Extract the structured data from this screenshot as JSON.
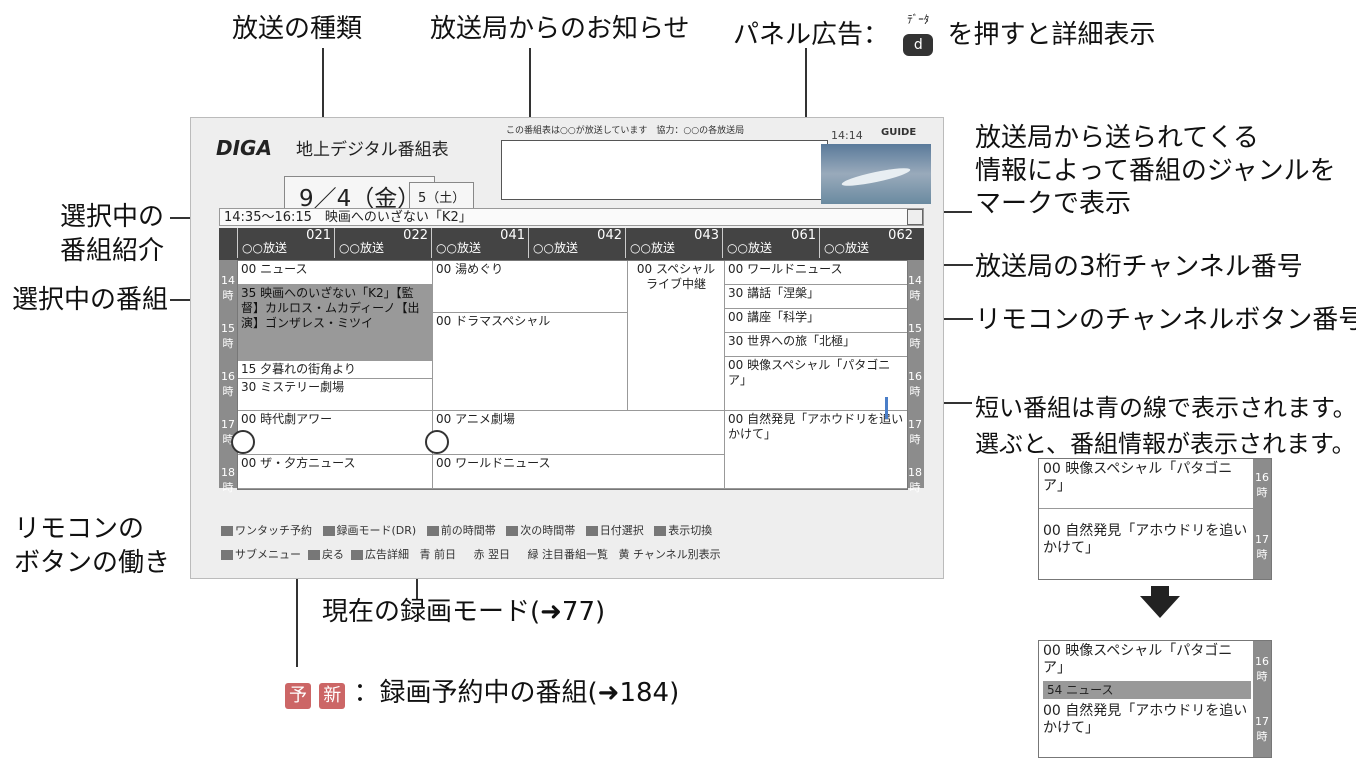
{
  "callouts": {
    "broadcast_type": "放送の種類",
    "station_notice": "放送局からのお知らせ",
    "panel_ad_prefix": "パネル広告：",
    "panel_ad_key_label": "ﾃﾞｰﾀ",
    "panel_ad_suffix": "を押すと詳細表示",
    "genre_mark_line1": "放送局から送られてくる",
    "genre_mark_line2": "情報によって番組のジャンルを",
    "genre_mark_line3": "マークで表示",
    "selected_intro_line1": "選択中の",
    "selected_intro_line2": "番組紹介",
    "selected_program": "選択中の番組",
    "channel_3digit": "放送局の3桁チャンネル番号",
    "remote_channel_button": "リモコンのチャンネルボタン番号",
    "short_program_line1": "短い番組は青の線で表示されます。",
    "short_program_line2": "選ぶと、番組情報が表示されます。",
    "remote_buttons_line1": "リモコンの",
    "remote_buttons_line2": "ボタンの働き",
    "rec_mode": "現在の録画モード(➜77)",
    "reserved_badge1": "予",
    "reserved_badge2": "新",
    "reserved_text": "：録画予約中の番組(➜184)"
  },
  "screen": {
    "logo": "DIGA",
    "title": "地上デジタル番組表",
    "notice_text": "この番組表は○○が放送しています　協力：○○の各放送局",
    "clock": "14:14",
    "guide_logo": "GUIDE",
    "date_main": "9／4（金）",
    "date_next": "5（土）",
    "selected_bar": "14:35～16:15　映画へのいざない「K2」",
    "channels": [
      {
        "num": "021",
        "name": "○○放送"
      },
      {
        "num": "022",
        "name": "○○放送"
      },
      {
        "num": "041",
        "name": "○○放送"
      },
      {
        "num": "042",
        "name": "○○放送"
      },
      {
        "num": "043",
        "name": "○○放送"
      },
      {
        "num": "061",
        "name": "○○放送"
      },
      {
        "num": "062",
        "name": "○○放送"
      }
    ],
    "hours": [
      "14時",
      "15時",
      "16時",
      "17時",
      "18時"
    ],
    "col1": [
      "00 ニュース",
      "35 映画へのいざない「K2」【監督】カルロス・ムカディーノ【出演】ゴンザレス・ミツイ",
      "15 夕暮れの街角より",
      "30 ミステリー劇場",
      "00 時代劇アワー",
      "00 ザ・夕方ニュース"
    ],
    "col2": [
      "00 湯めぐり",
      "00 ドラマスペシャル",
      "00 アニメ劇場",
      "00 ワールドニュース"
    ],
    "col3": [
      "00 スペシャルライブ中継"
    ],
    "col4": [
      "00 ワールドニュース",
      "30 講話「涅槃」",
      "00 講座「科学」",
      "30 世界への旅「北極」",
      "00 映像スペシャル「パタゴニア」",
      "00 自然発見「アホウドリを追いかけて」"
    ],
    "legend_row1": [
      "ワンタッチ予約",
      "録画モード(DR)",
      "前の時間帯",
      "次の時間帯",
      "日付選択",
      "表示切換"
    ],
    "legend_row2": [
      "サブメニュー",
      "戻る",
      "広告詳細",
      "青 前日",
      "赤 翌日",
      "緑 注目番組一覧",
      "黄 チャンネル別表示"
    ]
  },
  "side": {
    "before": [
      "00 映像スペシャル「パタゴニア」",
      "00 自然発見「アホウドリを追いかけて」"
    ],
    "after": [
      "00 映像スペシャル「パタゴニア」",
      "54 ニュース",
      "00 自然発見「アホウドリを追いかけて」"
    ],
    "hours": [
      "16時",
      "17時"
    ]
  }
}
